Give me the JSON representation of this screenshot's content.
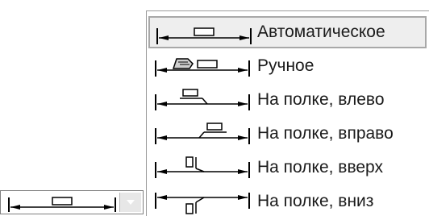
{
  "combo": {
    "preview_icon": "dimension-auto-icon",
    "arrow_icon": "chevron-down-icon"
  },
  "menu": {
    "selected_index": 0,
    "items": [
      {
        "label": "Автоматическое",
        "icon": "dimension-auto-icon"
      },
      {
        "label": "Ручное",
        "icon": "dimension-manual-icon"
      },
      {
        "label": "На полке, влево",
        "icon": "dimension-shelf-left-icon"
      },
      {
        "label": "На полке, вправо",
        "icon": "dimension-shelf-right-icon"
      },
      {
        "label": "На полке, вверх",
        "icon": "dimension-shelf-up-icon"
      },
      {
        "label": "На полке, вниз",
        "icon": "dimension-shelf-down-icon"
      }
    ]
  }
}
